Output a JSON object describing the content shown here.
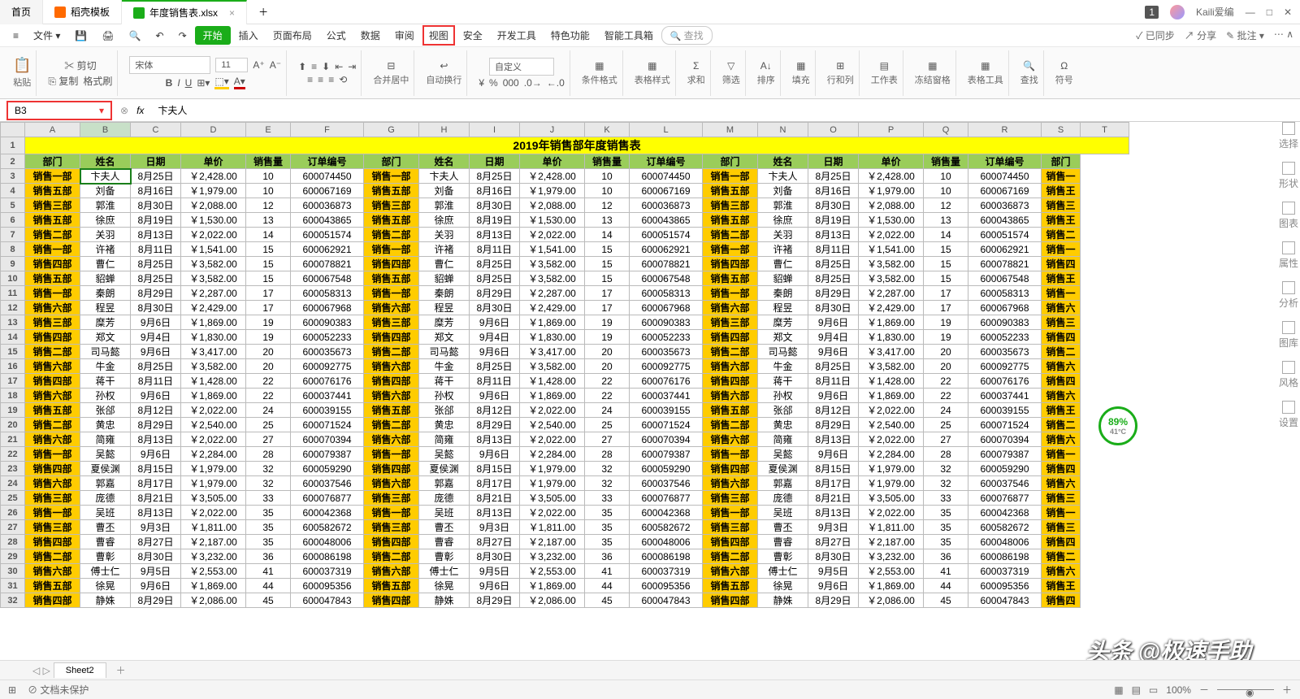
{
  "tabs": {
    "home": "首页",
    "t1": "稻壳模板",
    "t2": "年度销售表.xlsx"
  },
  "user": "Kaili爱编",
  "menu": {
    "file": "文件",
    "start": "开始",
    "insert": "插入",
    "layout": "页面布局",
    "formula": "公式",
    "data": "数据",
    "review": "审阅",
    "view": "视图",
    "security": "安全",
    "dev": "开发工具",
    "special": "特色功能",
    "ai": "智能工具箱",
    "search": "查找"
  },
  "menuRight": {
    "sync": "已同步",
    "share": "分享",
    "comment": "批注"
  },
  "ribbon": {
    "paste": "粘贴",
    "cut": "剪切",
    "copy": "复制",
    "painter": "格式刷",
    "font": "宋体",
    "size": "11",
    "merge": "合并居中",
    "wrap": "自动换行",
    "numfmt": "自定义",
    "condfmt": "条件格式",
    "tblstyle": "表格样式",
    "sum": "求和",
    "filter": "筛选",
    "sort": "排序",
    "fill": "填充",
    "rowcol": "行和列",
    "sheet": "工作表",
    "freeze": "冻结窗格",
    "tbltool": "表格工具",
    "find": "查找",
    "symbol": "符号"
  },
  "namebox": "B3",
  "formula": "卞夫人",
  "sheet": {
    "title": "2019年销售部年度销售表",
    "cols": [
      "A",
      "B",
      "C",
      "D",
      "E",
      "F",
      "G",
      "H",
      "I",
      "J",
      "K",
      "L",
      "M",
      "N",
      "O",
      "P",
      "Q",
      "R",
      "S",
      "T"
    ],
    "headers": [
      "部门",
      "姓名",
      "日期",
      "单价",
      "销售量",
      "订单编号"
    ],
    "lastHeader": "部门",
    "rows": [
      {
        "r": 3,
        "d": [
          "销售一部",
          "卞夫人",
          "8月25日",
          "￥2,428.00",
          "10",
          "600074450"
        ]
      },
      {
        "r": 4,
        "d": [
          "销售五部",
          "刘备",
          "8月16日",
          "￥1,979.00",
          "10",
          "600067169"
        ]
      },
      {
        "r": 5,
        "d": [
          "销售三部",
          "郭淮",
          "8月30日",
          "￥2,088.00",
          "12",
          "600036873"
        ]
      },
      {
        "r": 6,
        "d": [
          "销售五部",
          "徐庶",
          "8月19日",
          "￥1,530.00",
          "13",
          "600043865"
        ]
      },
      {
        "r": 7,
        "d": [
          "销售二部",
          "关羽",
          "8月13日",
          "￥2,022.00",
          "14",
          "600051574"
        ]
      },
      {
        "r": 8,
        "d": [
          "销售一部",
          "许褚",
          "8月11日",
          "￥1,541.00",
          "15",
          "600062921"
        ]
      },
      {
        "r": 9,
        "d": [
          "销售四部",
          "曹仁",
          "8月25日",
          "￥3,582.00",
          "15",
          "600078821"
        ]
      },
      {
        "r": 10,
        "d": [
          "销售五部",
          "貂蝉",
          "8月25日",
          "￥3,582.00",
          "15",
          "600067548"
        ]
      },
      {
        "r": 11,
        "d": [
          "销售一部",
          "秦朗",
          "8月29日",
          "￥2,287.00",
          "17",
          "600058313"
        ]
      },
      {
        "r": 12,
        "d": [
          "销售六部",
          "程昱",
          "8月30日",
          "￥2,429.00",
          "17",
          "600067968"
        ]
      },
      {
        "r": 13,
        "d": [
          "销售三部",
          "糜芳",
          "9月6日",
          "￥1,869.00",
          "19",
          "600090383"
        ]
      },
      {
        "r": 14,
        "d": [
          "销售四部",
          "郑文",
          "9月4日",
          "￥1,830.00",
          "19",
          "600052233"
        ]
      },
      {
        "r": 15,
        "d": [
          "销售二部",
          "司马懿",
          "9月6日",
          "￥3,417.00",
          "20",
          "600035673"
        ]
      },
      {
        "r": 16,
        "d": [
          "销售六部",
          "牛金",
          "8月25日",
          "￥3,582.00",
          "20",
          "600092775"
        ]
      },
      {
        "r": 17,
        "d": [
          "销售四部",
          "蒋干",
          "8月11日",
          "￥1,428.00",
          "22",
          "600076176"
        ]
      },
      {
        "r": 18,
        "d": [
          "销售六部",
          "孙权",
          "9月6日",
          "￥1,869.00",
          "22",
          "600037441"
        ]
      },
      {
        "r": 19,
        "d": [
          "销售五部",
          "张郃",
          "8月12日",
          "￥2,022.00",
          "24",
          "600039155"
        ]
      },
      {
        "r": 20,
        "d": [
          "销售二部",
          "黄忠",
          "8月29日",
          "￥2,540.00",
          "25",
          "600071524"
        ]
      },
      {
        "r": 21,
        "d": [
          "销售六部",
          "简雍",
          "8月13日",
          "￥2,022.00",
          "27",
          "600070394"
        ]
      },
      {
        "r": 22,
        "d": [
          "销售一部",
          "吴懿",
          "9月6日",
          "￥2,284.00",
          "28",
          "600079387"
        ]
      },
      {
        "r": 23,
        "d": [
          "销售四部",
          "夏侯渊",
          "8月15日",
          "￥1,979.00",
          "32",
          "600059290"
        ]
      },
      {
        "r": 24,
        "d": [
          "销售六部",
          "郭嘉",
          "8月17日",
          "￥1,979.00",
          "32",
          "600037546"
        ]
      },
      {
        "r": 25,
        "d": [
          "销售三部",
          "庞德",
          "8月21日",
          "￥3,505.00",
          "33",
          "600076877"
        ]
      },
      {
        "r": 26,
        "d": [
          "销售一部",
          "吴班",
          "8月13日",
          "￥2,022.00",
          "35",
          "600042368"
        ]
      },
      {
        "r": 27,
        "d": [
          "销售三部",
          "曹丕",
          "9月3日",
          "￥1,811.00",
          "35",
          "600582672"
        ]
      },
      {
        "r": 28,
        "d": [
          "销售四部",
          "曹睿",
          "8月27日",
          "￥2,187.00",
          "35",
          "600048006"
        ]
      },
      {
        "r": 29,
        "d": [
          "销售二部",
          "曹彰",
          "8月30日",
          "￥3,232.00",
          "36",
          "600086198"
        ]
      },
      {
        "r": 30,
        "d": [
          "销售六部",
          "傅士仁",
          "9月5日",
          "￥2,553.00",
          "41",
          "600037319"
        ]
      },
      {
        "r": 31,
        "d": [
          "销售五部",
          "徐晃",
          "9月6日",
          "￥1,869.00",
          "44",
          "600095356"
        ]
      },
      {
        "r": 32,
        "d": [
          "销售四部",
          "静姝",
          "8月29日",
          "￥2,086.00",
          "45",
          "600047843"
        ]
      }
    ],
    "lastCol": [
      "销售一",
      "销售王",
      "销售三",
      "销售王",
      "销售二",
      "销售一",
      "销售四",
      "销售王",
      "销售一",
      "销售六",
      "销售三",
      "销售四",
      "销售二",
      "销售六",
      "销售四",
      "销售六",
      "销售王",
      "销售二",
      "销售六",
      "销售一",
      "销售四",
      "销售六",
      "销售三",
      "销售一",
      "销售三",
      "销售四",
      "销售二",
      "销售六",
      "销售王",
      "销售四"
    ]
  },
  "sheetTab": "Sheet2",
  "status": {
    "protect": "文档未保护",
    "zoom": "100%"
  },
  "rpanel": [
    "选择",
    "形状",
    "图表",
    "属性",
    "分析",
    "图库",
    "风格",
    "设置"
  ],
  "badge": {
    "pct": "89%",
    "temp": "41°C"
  },
  "watermark": "头条 @极速手助"
}
